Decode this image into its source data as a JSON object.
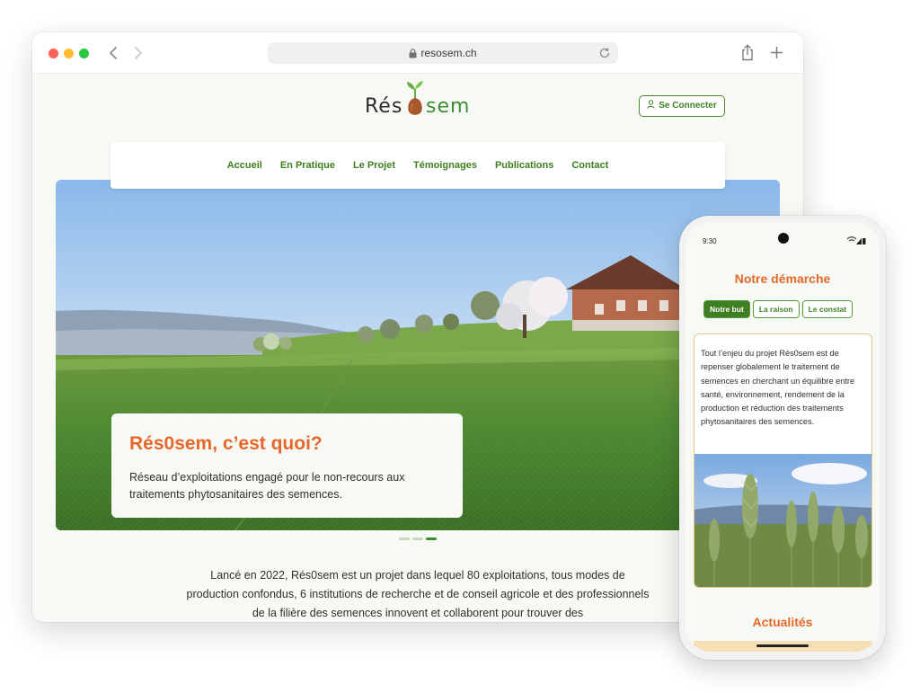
{
  "browser": {
    "url": "resosem.ch"
  },
  "site": {
    "logo_left": "Rés",
    "logo_right": "sem",
    "connect_label": "Se Connecter",
    "nav": [
      "Accueil",
      "En Pratique",
      "Le Projet",
      "Témoignages",
      "Publications",
      "Contact"
    ],
    "hero": {
      "title": "Rés0sem, c’est quoi?",
      "text": "Réseau d’exploitations engagé pour le non-recours aux traitements phytosanitaires des semences."
    },
    "carousel": {
      "slides": 3,
      "active_index": 3
    },
    "intro": "Lancé en 2022, Rés0sem est un projet dans lequel 80 exploitations, tous modes de production confondus, 6 institutions de recherche et de conseil agricole et des professionnels de la filière des semences innovent et collaborent pour trouver des"
  },
  "phone": {
    "time": "9:30",
    "heading": "Notre démarche",
    "tabs": [
      {
        "label": "Notre but",
        "active": true
      },
      {
        "label": "La raison",
        "active": false
      },
      {
        "label": "Le constat",
        "active": false
      }
    ],
    "card_text": "Tout l’enjeu du projet Rés0sem est de repenser globalement le traitement de semences en cherchant un équilibre entre santé, environnement, rendement de la production et réduction des traitements phytosanitaires des semences.",
    "news_heading": "Actualités"
  },
  "colors": {
    "brand_green": "#3f7f24",
    "accent_orange": "#e6672a",
    "page_background": "#f7faf4",
    "card_border": "#e8c88f"
  },
  "icons": [
    "back-arrow-icon",
    "forward-arrow-icon",
    "lock-icon",
    "reload-icon",
    "share-icon",
    "new-tab-plus-icon",
    "user-icon",
    "sprout-seed-logo-icon",
    "signal-icon",
    "battery-icon"
  ]
}
